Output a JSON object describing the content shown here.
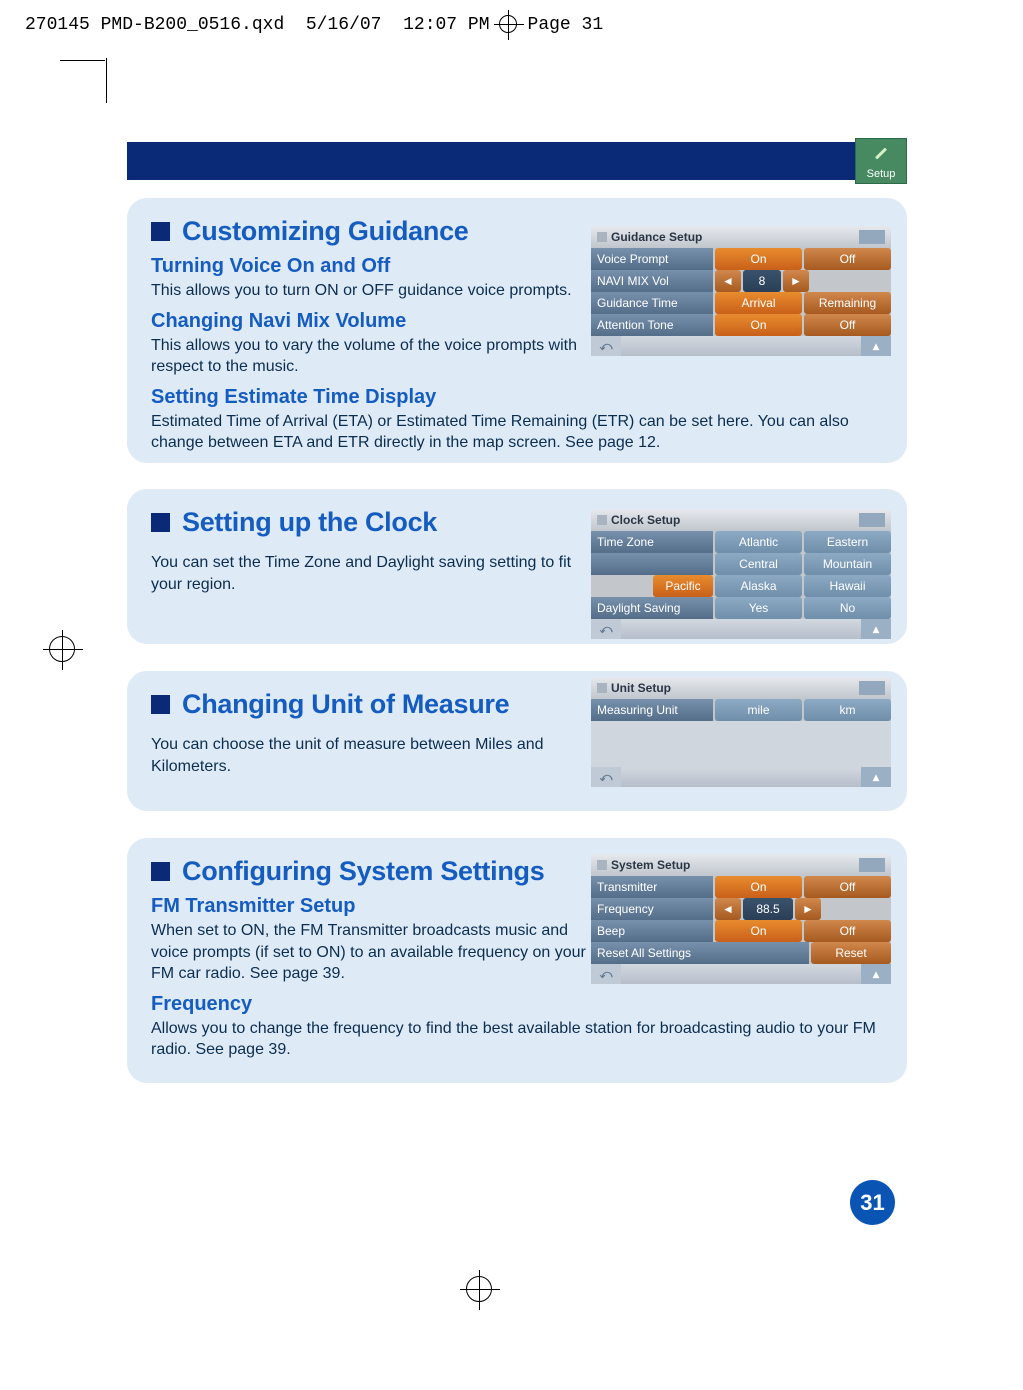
{
  "print_header": {
    "filename": "270145 PMD-B200_0516.qxd",
    "date": "5/16/07",
    "time": "12:07 PM",
    "page_word": "Page",
    "page_no": "31"
  },
  "band": {
    "setup_label": "Setup"
  },
  "sections": {
    "guidance": {
      "title": "Customizing Guidance",
      "voice": {
        "heading": "Turning Voice On and Off",
        "body": "This allows you to turn ON or OFF guidance voice prompts."
      },
      "navi": {
        "heading": "Changing Navi Mix Volume",
        "body": "This allows you to vary the volume of the voice prompts with respect to the music."
      },
      "eta": {
        "heading": "Setting Estimate Time Display",
        "body": "Estimated Time of Arrival (ETA) or Estimated Time Remaining (ETR) can be set here. You can also change between ETA and ETR directly in the map screen. See page 12."
      }
    },
    "clock": {
      "title": "Setting up the Clock",
      "body": "You can set the Time Zone and Daylight saving setting to fit your region."
    },
    "unit": {
      "title": "Changing Unit of Measure",
      "body": "You can choose the unit of measure between Miles and Kilometers."
    },
    "system": {
      "title": "Configuring System Settings",
      "fm": {
        "heading": "FM Transmitter Setup",
        "body": "When set to ON, the FM Transmitter broadcasts music and voice prompts (if set to ON) to an available frequency on your FM car radio. See page 39."
      },
      "freq": {
        "heading": "Frequency",
        "body": "Allows you to change the frequency to find the best available station for broadcasting audio to your FM radio. See page 39."
      }
    }
  },
  "screens": {
    "guidance": {
      "title": "Guidance Setup",
      "rows": {
        "voice_prompt": {
          "label": "Voice Prompt",
          "opt_on": "On",
          "opt_off": "Off"
        },
        "navi_mix": {
          "label": "NAVI MIX Vol",
          "arrow_l": "◄",
          "value": "8",
          "arrow_r": "►"
        },
        "guidance_time": {
          "label": "Guidance Time",
          "opt_a": "Arrival",
          "opt_b": "Remaining"
        },
        "attention": {
          "label": "Attention Tone",
          "opt_on": "On",
          "opt_off": "Off"
        }
      },
      "back": "⤺",
      "fwd": "▴"
    },
    "clock": {
      "title": "Clock Setup",
      "tz_label": "Time Zone",
      "tz": {
        "atlantic": "Atlantic",
        "eastern": "Eastern",
        "central": "Central",
        "mountain": "Mountain",
        "pacific": "Pacific",
        "alaska": "Alaska",
        "hawaii": "Hawaii"
      },
      "daylight": {
        "label": "Daylight Saving",
        "yes": "Yes",
        "no": "No"
      },
      "back": "⤺",
      "fwd": "▴"
    },
    "unit": {
      "title": "Unit Setup",
      "row": {
        "label": "Measuring Unit",
        "mile": "mile",
        "km": "km"
      },
      "back": "⤺",
      "fwd": "▴"
    },
    "system": {
      "title": "System Setup",
      "transmitter": {
        "label": "Transmitter",
        "on": "On",
        "off": "Off"
      },
      "frequency": {
        "label": "Frequency",
        "arrow_l": "◄",
        "value": "88.5",
        "arrow_r": "►"
      },
      "beep": {
        "label": "Beep",
        "on": "On",
        "off": "Off"
      },
      "reset": {
        "label": "Reset All Settings",
        "btn": "Reset"
      },
      "back": "⤺",
      "fwd": "▴"
    }
  },
  "page_number": "31"
}
